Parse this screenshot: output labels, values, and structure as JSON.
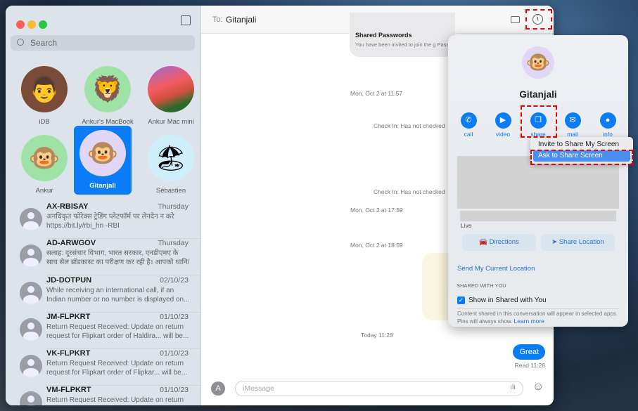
{
  "sidebar": {
    "search_placeholder": "Search",
    "pinned": [
      {
        "name": "iDB",
        "emoji": "👨"
      },
      {
        "name": "Ankur's MacBook",
        "emoji": "🦁"
      },
      {
        "name": "Ankur Mac mini",
        "emoji": ""
      },
      {
        "name": "Ankur",
        "emoji": "🐵"
      },
      {
        "name": "Gitanjali",
        "emoji": "🐵"
      },
      {
        "name": "Sébastien",
        "emoji": "🏖"
      }
    ],
    "conversations": [
      {
        "title": "AX-RBISAY",
        "date": "Thursday",
        "preview": "अनधिकृत फोरेक्स ट्रेडिंग प्लेटफॉर्म पर लेनदेन न करे https://bit.ly/rbi_hn -RBI"
      },
      {
        "title": "AD-ARWGOV",
        "date": "Thursday",
        "preview": "सलाह: दूरसंचार विभाग, भारत सरकार, एनडीएमए के साथ सेल ब्रॉडकास्ट का परीक्षण कर रही है। आपको ध्वनि/ कंप..."
      },
      {
        "title": "JD-DOTPUN",
        "date": "02/10/23",
        "preview": "While receiving an international call, if an Indian number or no number is displayed on..."
      },
      {
        "title": "JM-FLPKRT",
        "date": "01/10/23",
        "preview": "Return Request Received: Update on return request for Flipkart order of Haldira... will be..."
      },
      {
        "title": "VK-FLPKRT",
        "date": "01/10/23",
        "preview": "Return Request Received: Update on return request for Flipkart order of Flipkar... will be..."
      },
      {
        "title": "VM-FLPKRT",
        "date": "01/10/23",
        "preview": "Return Request Received: Update on return"
      }
    ]
  },
  "header": {
    "to_label": "To:",
    "recipient": "Gitanjali"
  },
  "chat": {
    "card_title": "Shared Passwords",
    "card_text": "You have been invited to join the g Passwords\".",
    "ts1": "Mon, Oct 2 at 11:57",
    "checkin1": "Check In: Has not checked",
    "checkin2": "Check In: Has not checked",
    "ts2": "Mon, Oct 2 at 17:59",
    "ts3": "Mon, Oct 2 at 18:59",
    "ts4": "Today 11:28",
    "bubble": "Great",
    "read": "Read 11:28",
    "input_placeholder": "iMessage"
  },
  "details": {
    "name": "Gitanjali",
    "actions": [
      "call",
      "video",
      "share",
      "mail",
      "info"
    ],
    "live": "Live",
    "directions": "Directions",
    "share_location": "Share Location",
    "send_location": "Send My Current Location",
    "shared_header": "SHARED WITH YOU",
    "show_shared": "Show in Shared with You",
    "footer": "Content shared in this conversation will appear in selected apps. Pins will always show.",
    "learn_more": "Learn more"
  },
  "share_menu": {
    "items": [
      "Invite to Share My Screen",
      "Ask to Share Screen"
    ],
    "highlighted": "Ask to Share Screen"
  }
}
